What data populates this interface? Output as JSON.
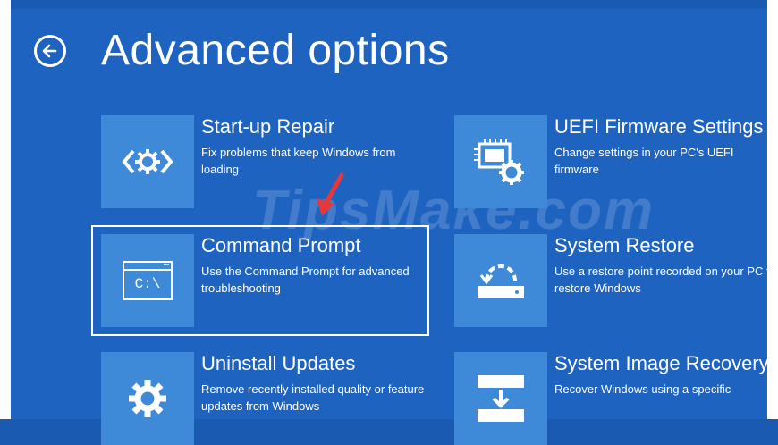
{
  "title": "Advanced options",
  "watermark": "TipsMake.com",
  "options": [
    {
      "title": "Start-up Repair",
      "desc": "Fix problems that keep Windows from loading",
      "icon": "startup-repair-icon"
    },
    {
      "title": "UEFI Firmware Settings",
      "desc": "Change settings in your PC's UEFI firmware",
      "icon": "firmware-chip-icon"
    },
    {
      "title": "Command Prompt",
      "desc": "Use the Command Prompt for advanced troubleshooting",
      "icon": "command-prompt-icon",
      "tile_text": "C:\\"
    },
    {
      "title": "System Restore",
      "desc": "Use a restore point recorded on your PC to restore Windows",
      "icon": "system-restore-icon"
    },
    {
      "title": "Uninstall Updates",
      "desc": "Remove recently installed quality or feature updates from Windows",
      "icon": "gear-icon"
    },
    {
      "title": "System Image Recovery",
      "desc": "Recover Windows using a specific",
      "icon": "system-image-icon"
    }
  ],
  "selected_option": "Command Prompt",
  "colors": {
    "background": "#1e63c0",
    "tile": "#3f8ad8",
    "arrow": "#e8373a"
  }
}
